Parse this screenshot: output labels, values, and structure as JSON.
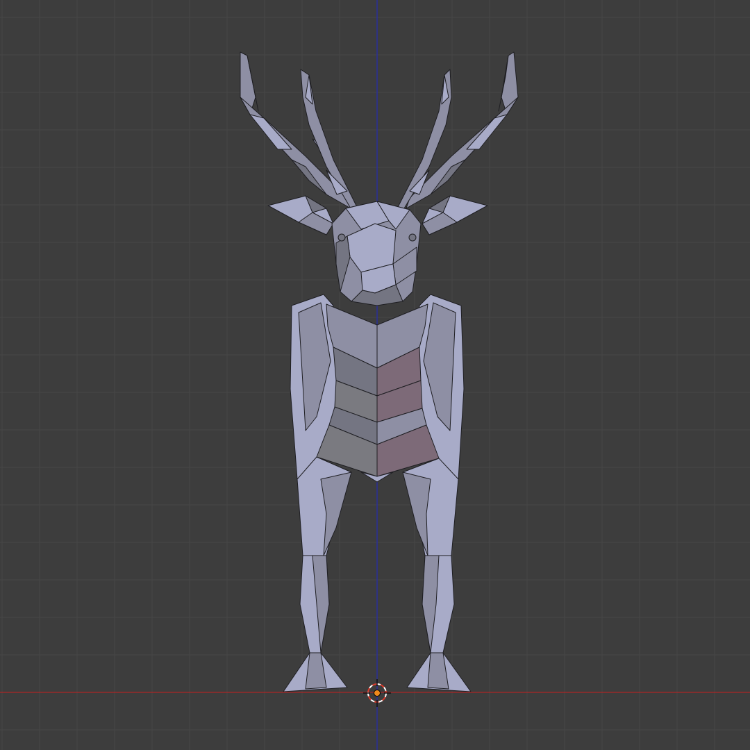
{
  "viewport": {
    "view": "front-orthographic",
    "colors": {
      "background": "#3d3d3d",
      "grid_minor": "#474747",
      "grid_major": "#4f4f4f",
      "x_axis": "#9a2a2a",
      "z_axis": "#2a2f9a",
      "mesh_light": "#a8abc8",
      "mesh_mid": "#8e8fa4",
      "mesh_dark": "#747582",
      "mesh_chest_left": "#7a7a80",
      "mesh_chest_right": "#7d6a78",
      "wire": "#1e1e22",
      "cursor_ring_a": "#ffffff",
      "cursor_ring_b": "#e03a2a",
      "origin": "#f08a1c"
    }
  },
  "objects": [
    {
      "name": "low-poly-deer",
      "type": "mesh",
      "selected": false
    }
  ]
}
